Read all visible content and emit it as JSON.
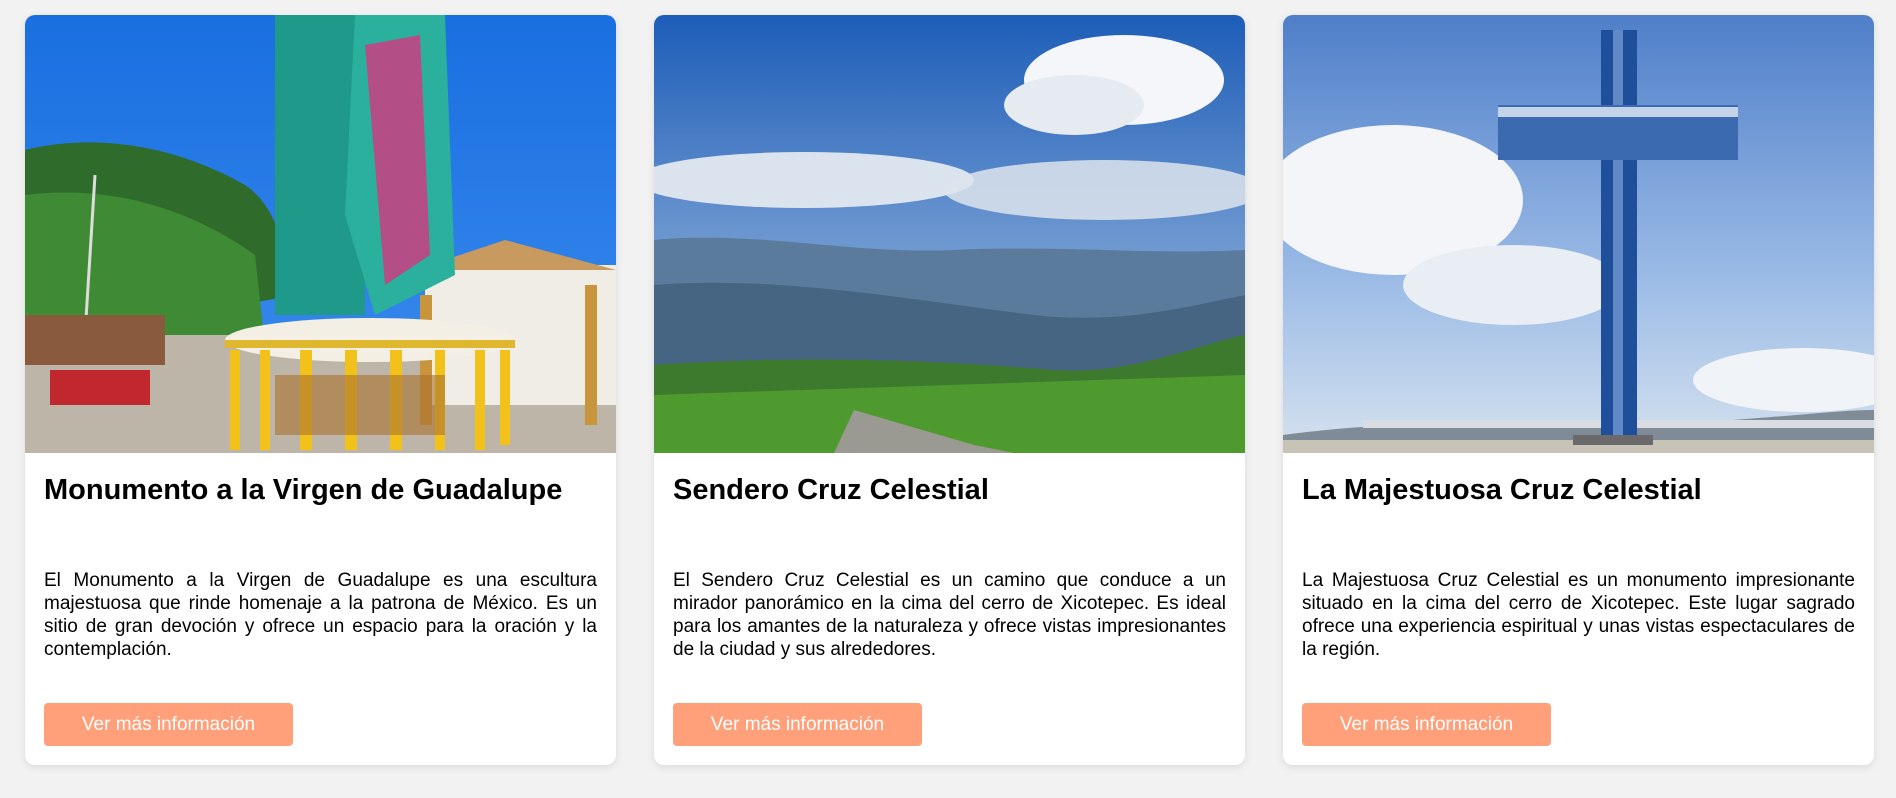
{
  "colors": {
    "page_bg": "#f2f2f2",
    "card_bg": "#ffffff",
    "button_bg": "#ffa07a",
    "button_text": "#ffffff"
  },
  "cards": [
    {
      "title": "Monumento a la Virgen de Guadalupe",
      "description": "El Monumento a la Virgen de Guadalupe es una escultura majestuosa que rinde homenaje a la patrona de México. Es un sitio de gran devoción y ofrece un espacio para la oración y la contemplación.",
      "button_label": "Ver más información",
      "image_icon": "virgin-statue-photo"
    },
    {
      "title": "Sendero Cruz Celestial",
      "description": "El Sendero Cruz Celestial es un camino que conduce a un mirador panorámico en la cima del cerro de Xicotepec. Es ideal para los amantes de la naturaleza y ofrece vistas impresionantes de la ciudad y sus alrededores.",
      "button_label": "Ver más información",
      "image_icon": "mountain-landscape-photo"
    },
    {
      "title": "La Majestuosa Cruz Celestial",
      "description": "La Majestuosa Cruz Celestial es un monumento impresionante situado en la cima del cerro de Xicotepec. Este lugar sagrado ofrece una experiencia espiritual y unas vistas espectaculares de la región.",
      "button_label": "Ver más información",
      "image_icon": "cross-monument-photo"
    }
  ]
}
